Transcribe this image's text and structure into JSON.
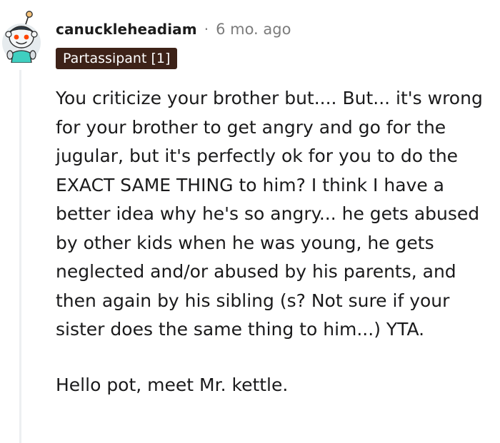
{
  "comment": {
    "author": "canuckleheadiam",
    "separator": "·",
    "age": "6 mo. ago",
    "flair": "Partassipant [1]",
    "paragraphs": [
      "You criticize your brother but.... But... it's wrong for your brother to get angry and go for the jugular, but it's perfectly ok for you to do the EXACT SAME THING to him? I think I have a better idea why he's so angry... he gets abused by other kids when he was young, he gets neglected and/or abused by his parents, and then again by his sibling (s? Not sure if your sister does the same thing to him...) YTA.",
      "Hello pot, meet Mr. kettle."
    ]
  },
  "colors": {
    "flair_background": "#3d2218",
    "flair_text": "#ffffff",
    "username": "#1c1c1c",
    "muted": "#7c7c7c",
    "thread_line": "#edeff1",
    "avatar_teal": "#3fcfc0"
  },
  "icons": {
    "avatar": "snoo-avatar-icon"
  }
}
